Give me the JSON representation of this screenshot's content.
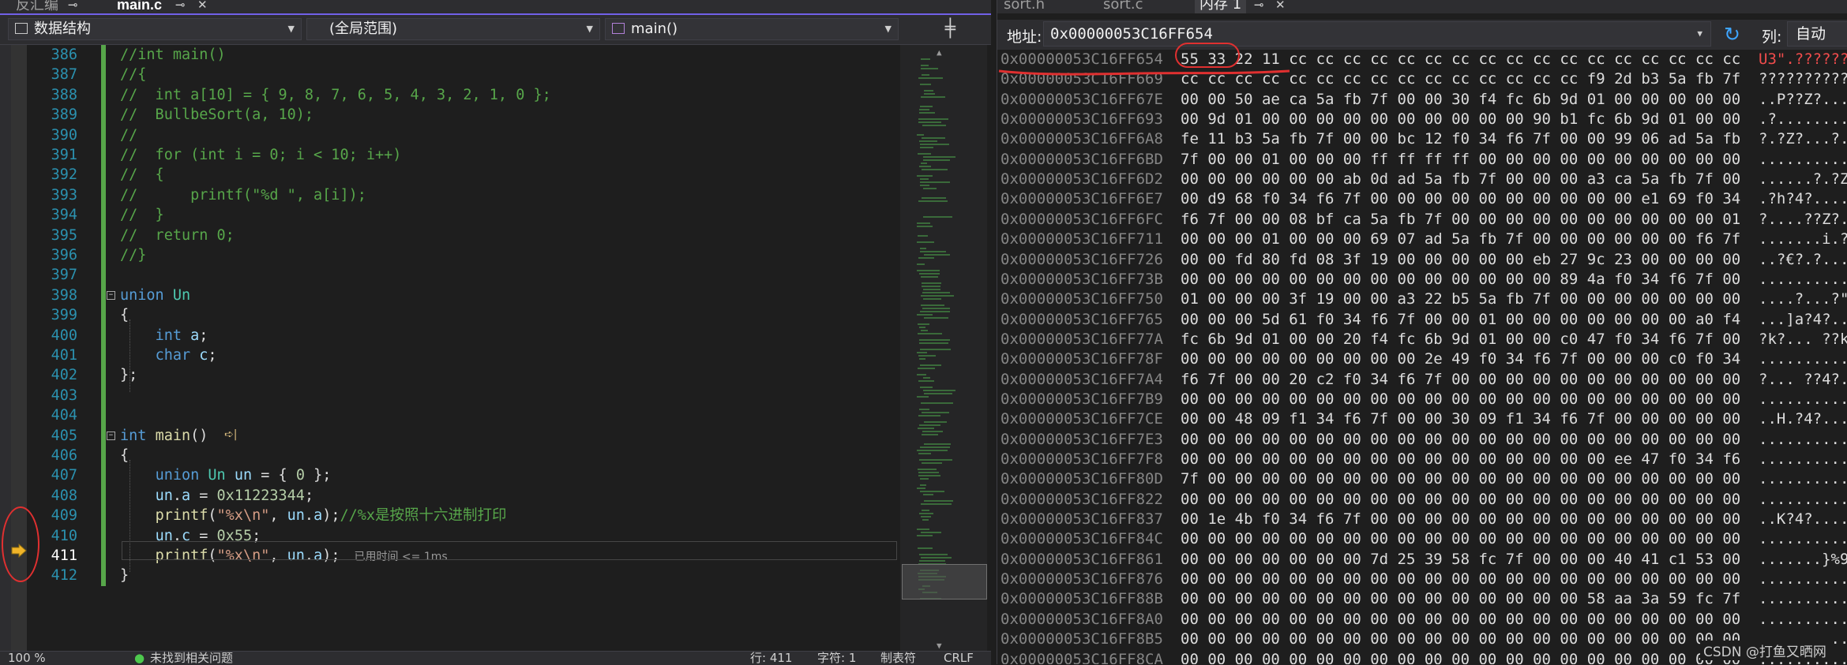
{
  "editor": {
    "tabs": [
      {
        "label": "反汇编",
        "icon": "pin-icon"
      },
      {
        "label": "main.c",
        "icon": "pin-icon",
        "active": true
      }
    ],
    "nav": {
      "project": "数据结构",
      "scope": "(全局范围)",
      "function": "main()"
    },
    "current_line": 411,
    "inline_hint": "已用时间 <= 1ms",
    "lines": [
      {
        "n": 386,
        "tokens": [
          [
            "c-com",
            "//int main()"
          ]
        ]
      },
      {
        "n": 387,
        "tokens": [
          [
            "c-com",
            "//{"
          ]
        ]
      },
      {
        "n": 388,
        "tokens": [
          [
            "c-com",
            "//  int a[10] = { 9, 8, 7, 6, 5, 4, 3, 2, 1, 0 };"
          ]
        ]
      },
      {
        "n": 389,
        "tokens": [
          [
            "c-com",
            "//  BullbeSort(a, 10);"
          ]
        ]
      },
      {
        "n": 390,
        "tokens": [
          [
            "c-com",
            "//"
          ]
        ]
      },
      {
        "n": 391,
        "tokens": [
          [
            "c-com",
            "//  for (int i = 0; i < 10; i++)"
          ]
        ]
      },
      {
        "n": 392,
        "tokens": [
          [
            "c-com",
            "//  {"
          ]
        ]
      },
      {
        "n": 393,
        "tokens": [
          [
            "c-com",
            "//      printf(\"%d \", a[i]);"
          ]
        ]
      },
      {
        "n": 394,
        "tokens": [
          [
            "c-com",
            "//  }"
          ]
        ]
      },
      {
        "n": 395,
        "tokens": [
          [
            "c-com",
            "//  return 0;"
          ]
        ]
      },
      {
        "n": 396,
        "tokens": [
          [
            "c-com",
            "//}"
          ]
        ]
      },
      {
        "n": 397,
        "tokens": []
      },
      {
        "n": 398,
        "tokens": [
          [
            "c-kw",
            "union"
          ],
          [
            "c-plain",
            " "
          ],
          [
            "c-type",
            "Un"
          ]
        ]
      },
      {
        "n": 399,
        "tokens": [
          [
            "c-plain",
            "{"
          ]
        ]
      },
      {
        "n": 400,
        "tokens": [
          [
            "c-plain",
            "    "
          ],
          [
            "c-kw",
            "int"
          ],
          [
            "c-plain",
            " "
          ],
          [
            "c-var",
            "a"
          ],
          [
            "c-plain",
            ";"
          ]
        ]
      },
      {
        "n": 401,
        "tokens": [
          [
            "c-plain",
            "    "
          ],
          [
            "c-kw",
            "char"
          ],
          [
            "c-plain",
            " "
          ],
          [
            "c-var",
            "c"
          ],
          [
            "c-plain",
            ";"
          ]
        ]
      },
      {
        "n": 402,
        "tokens": [
          [
            "c-plain",
            "};"
          ]
        ]
      },
      {
        "n": 403,
        "tokens": []
      },
      {
        "n": 404,
        "tokens": []
      },
      {
        "n": 405,
        "tokens": [
          [
            "c-kw",
            "int"
          ],
          [
            "c-plain",
            " "
          ],
          [
            "c-fn",
            "main"
          ],
          [
            "c-plain",
            "()"
          ]
        ]
      },
      {
        "n": 406,
        "tokens": [
          [
            "c-plain",
            "{"
          ]
        ]
      },
      {
        "n": 407,
        "tokens": [
          [
            "c-plain",
            "    "
          ],
          [
            "c-kw",
            "union"
          ],
          [
            "c-plain",
            " "
          ],
          [
            "c-type",
            "Un"
          ],
          [
            "c-plain",
            " "
          ],
          [
            "c-var",
            "un"
          ],
          [
            "c-plain",
            " = { "
          ],
          [
            "c-num",
            "0"
          ],
          [
            "c-plain",
            " };"
          ]
        ]
      },
      {
        "n": 408,
        "tokens": [
          [
            "c-plain",
            "    "
          ],
          [
            "c-var",
            "un"
          ],
          [
            "c-plain",
            "."
          ],
          [
            "c-var",
            "a"
          ],
          [
            "c-plain",
            " = "
          ],
          [
            "c-num",
            "0x11223344"
          ],
          [
            "c-plain",
            ";"
          ]
        ]
      },
      {
        "n": 409,
        "tokens": [
          [
            "c-plain",
            "    "
          ],
          [
            "c-fn",
            "printf"
          ],
          [
            "c-plain",
            "("
          ],
          [
            "c-str",
            "\"%x\\n\""
          ],
          [
            "c-plain",
            ", "
          ],
          [
            "c-var",
            "un"
          ],
          [
            "c-plain",
            "."
          ],
          [
            "c-var",
            "a"
          ],
          [
            "c-plain",
            ");"
          ],
          [
            "c-com",
            "//%x是按照十六进制打印"
          ]
        ]
      },
      {
        "n": 410,
        "tokens": [
          [
            "c-plain",
            "    "
          ],
          [
            "c-var",
            "un"
          ],
          [
            "c-plain",
            "."
          ],
          [
            "c-var",
            "c"
          ],
          [
            "c-plain",
            " = "
          ],
          [
            "c-num",
            "0x55"
          ],
          [
            "c-plain",
            ";"
          ]
        ]
      },
      {
        "n": 411,
        "tokens": [
          [
            "c-plain",
            "    "
          ],
          [
            "c-fn",
            "printf"
          ],
          [
            "c-plain",
            "("
          ],
          [
            "c-str",
            "\"%x\\n\""
          ],
          [
            "c-plain",
            ", "
          ],
          [
            "c-var",
            "un"
          ],
          [
            "c-plain",
            "."
          ],
          [
            "c-var",
            "a"
          ],
          [
            "c-plain",
            ");"
          ]
        ]
      },
      {
        "n": 412,
        "tokens": [
          [
            "c-plain",
            "}"
          ]
        ]
      }
    ],
    "status": {
      "zoom": "100 %",
      "issues": "未找到相关问题",
      "row": "行: 411",
      "char": "字符: 1",
      "indent": "制表符",
      "eol": "CRLF"
    }
  },
  "memory": {
    "tabs": [
      "sort.h",
      "sort.c",
      "内存 1"
    ],
    "address_label": "地址:",
    "address_value": "0x00000053C16FF654",
    "columns_label": "列:",
    "columns_value": "自动",
    "watermark": "CSDN @打鱼又晒网",
    "rows": [
      {
        "addr": "0x00000053C16FF654",
        "bytes": "55 33 22 11 cc cc cc cc cc cc cc cc cc cc cc cc cc cc cc cc cc",
        "ascii": "U3\".??????",
        "highlight": true
      },
      {
        "addr": "0x00000053C16FF669",
        "bytes": "cc cc cc cc cc cc cc cc cc cc cc cc cc cc cc f9 2d b3 5a fb 7f",
        "ascii": "??????????"
      },
      {
        "addr": "0x00000053C16FF67E",
        "bytes": "00 00 50 ae ca 5a fb 7f 00 00 30 f4 fc 6b 9d 01 00 00 00 00 00",
        "ascii": "..P??Z?..."
      },
      {
        "addr": "0x00000053C16FF693",
        "bytes": "00 9d 01 00 00 00 00 00 00 00 00 00 00 90 b1 fc 6b 9d 01 00 00",
        "ascii": ".?........"
      },
      {
        "addr": "0x00000053C16FF6A8",
        "bytes": "fe 11 b3 5a fb 7f 00 00 bc 12 f0 34 f6 7f 00 00 99 06 ad 5a fb",
        "ascii": "?.?Z?...?."
      },
      {
        "addr": "0x00000053C16FF6BD",
        "bytes": "7f 00 00 01 00 00 00 ff ff ff ff 00 00 00 00 00 00 00 00 00 00",
        "ascii": ".........."
      },
      {
        "addr": "0x00000053C16FF6D2",
        "bytes": "00 00 00 00 00 00 ab 0d ad 5a fb 7f 00 00 00 a3 ca 5a fb 7f 00",
        "ascii": "......?.?Z"
      },
      {
        "addr": "0x00000053C16FF6E7",
        "bytes": "00 d9 68 f0 34 f6 7f 00 00 00 00 00 00 00 00 00 00 e1 69 f0 34",
        "ascii": ".?h?4?...."
      },
      {
        "addr": "0x00000053C16FF6FC",
        "bytes": "f6 7f 00 00 08 bf ca 5a fb 7f 00 00 00 00 00 00 00 00 00 00 01",
        "ascii": "?....??Z?."
      },
      {
        "addr": "0x00000053C16FF711",
        "bytes": "00 00 00 01 00 00 00 69 07 ad 5a fb 7f 00 00 00 00 00 00 f6 7f",
        "ascii": ".......i.?"
      },
      {
        "addr": "0x00000053C16FF726",
        "bytes": "00 00 fd 80 fd 08 3f 19 00 00 00 00 00 eb 27 9c 23 00 00 00 00",
        "ascii": "..?€?.?..."
      },
      {
        "addr": "0x00000053C16FF73B",
        "bytes": "00 00 00 00 00 00 00 00 00 00 00 00 00 00 89 4a f0 34 f6 7f 00",
        "ascii": ".........."
      },
      {
        "addr": "0x00000053C16FF750",
        "bytes": "01 00 00 00 3f 19 00 00 a3 22 b5 5a fb 7f 00 00 00 00 00 00 00",
        "ascii": "....?...?\""
      },
      {
        "addr": "0x00000053C16FF765",
        "bytes": "00 00 00 5d 61 f0 34 f6 7f 00 00 01 00 00 00 00 00 00 00 a0 f4",
        "ascii": "...]a?4?.."
      },
      {
        "addr": "0x00000053C16FF77A",
        "bytes": "fc 6b 9d 01 00 00 20 f4 fc 6b 9d 01 00 00 c0 47 f0 34 f6 7f 00",
        "ascii": "?k?... ??k"
      },
      {
        "addr": "0x00000053C16FF78F",
        "bytes": "00 00 00 00 00 00 00 00 00 2e 49 f0 34 f6 7f 00 00 00 c0 f0 34",
        "ascii": ".........."
      },
      {
        "addr": "0x00000053C16FF7A4",
        "bytes": "f6 7f 00 00 20 c2 f0 34 f6 7f 00 00 00 00 00 00 00 00 00 00 00",
        "ascii": "?... ??4?."
      },
      {
        "addr": "0x00000053C16FF7B9",
        "bytes": "00 00 00 00 00 00 00 00 00 00 00 00 00 00 00 00 00 00 00 00 00",
        "ascii": ".........."
      },
      {
        "addr": "0x00000053C16FF7CE",
        "bytes": "00 00 48 09 f1 34 f6 7f 00 00 30 09 f1 34 f6 7f 00 00 00 00 00",
        "ascii": "..H.?4?..."
      },
      {
        "addr": "0x00000053C16FF7E3",
        "bytes": "00 00 00 00 00 00 00 00 00 00 00 00 00 00 00 00 00 00 00 00 00",
        "ascii": ".........."
      },
      {
        "addr": "0x00000053C16FF7F8",
        "bytes": "00 00 00 00 00 00 00 00 00 00 00 00 00 00 00 00 ee 47 f0 34 f6",
        "ascii": ".........."
      },
      {
        "addr": "0x00000053C16FF80D",
        "bytes": "7f 00 00 00 00 00 00 00 00 00 00 00 00 00 00 00 00 00 00 00 00",
        "ascii": ".........."
      },
      {
        "addr": "0x00000053C16FF822",
        "bytes": "00 00 00 00 00 00 00 00 00 00 00 00 00 00 00 00 00 00 00 00 00",
        "ascii": ".........."
      },
      {
        "addr": "0x00000053C16FF837",
        "bytes": "00 1e 4b f0 34 f6 7f 00 00 00 00 00 00 00 00 00 00 00 00 00 00",
        "ascii": "..K?4?...."
      },
      {
        "addr": "0x00000053C16FF84C",
        "bytes": "00 00 00 00 00 00 00 00 00 00 00 00 00 00 00 00 00 00 00 00 00",
        "ascii": ".........."
      },
      {
        "addr": "0x00000053C16FF861",
        "bytes": "00 00 00 00 00 00 00 7d 25 39 58 fc 7f 00 00 00 40 41 c1 53 00",
        "ascii": ".......}%9"
      },
      {
        "addr": "0x00000053C16FF876",
        "bytes": "00 00 00 00 00 00 00 00 00 00 00 00 00 00 00 00 00 00 00 00 00",
        "ascii": ".........."
      },
      {
        "addr": "0x00000053C16FF88B",
        "bytes": "00 00 00 00 00 00 00 00 00 00 00 00 00 00 00 58 aa 3a 59 fc 7f",
        "ascii": ".........."
      },
      {
        "addr": "0x00000053C16FF8A0",
        "bytes": "00 00 00 00 00 00 00 00 00 00 00 00 00 00 00 00 00 00 00 00 00",
        "ascii": ".........."
      },
      {
        "addr": "0x00000053C16FF8B5",
        "bytes": "00 00 00 00 00 00 00 00 00 00 00 00 00 00 00 00 00 00 00 00 00",
        "ascii": ".........."
      },
      {
        "addr": "0x00000053C16FF8CA",
        "bytes": "00 00 00 00 00 00 00 00 00 00 00 00 00 00 00 00 00 00 00 00 00",
        "ascii": ".........."
      }
    ]
  },
  "colors": {
    "accent": "#7160e8",
    "annotation_red": "#e03030",
    "breakpoint_arrow": "#f0b429",
    "change_bar": "#57a64a"
  }
}
